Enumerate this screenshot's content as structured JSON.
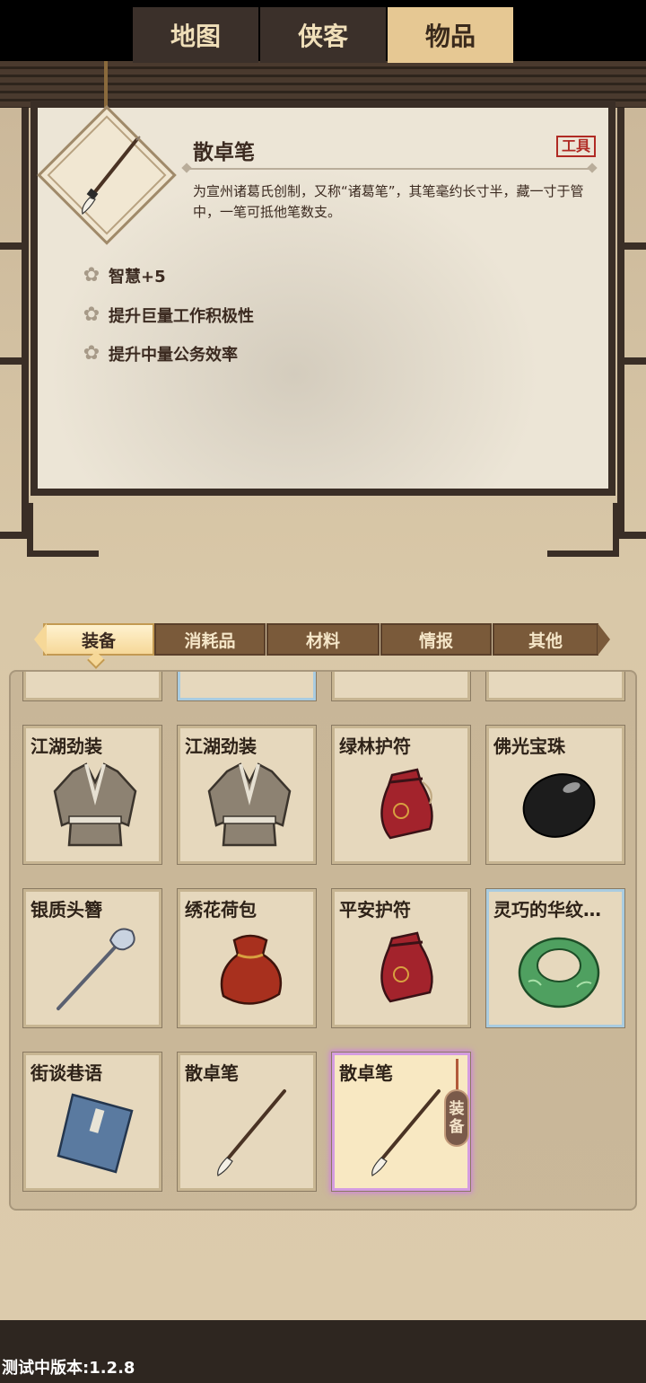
{
  "detail": {
    "name": "散卓笔",
    "type_tag": "工具",
    "description": "为宣州诸葛氏创制，又称“诸葛笔”，其笔毫约长寸半，藏一寸于管中，一笔可抵他笔数支。",
    "stats": [
      "智慧+5",
      "提升巨量工作积极性",
      "提升中量公务效率"
    ],
    "icon": "brush-icon"
  },
  "tabs": [
    {
      "label": "装备",
      "active": true
    },
    {
      "label": "消耗品",
      "active": false
    },
    {
      "label": "材料",
      "active": false
    },
    {
      "label": "情报",
      "active": false
    },
    {
      "label": "其他",
      "active": false
    }
  ],
  "items": [
    {
      "label": "江湖劲装",
      "icon": "robe-icon"
    },
    {
      "label": "江湖劲装",
      "icon": "robe-icon"
    },
    {
      "label": "绿林护符",
      "icon": "pouch-icon"
    },
    {
      "label": "佛光宝珠",
      "icon": "black-pearl-icon"
    },
    {
      "label": "银质头簪",
      "icon": "hairpin-icon"
    },
    {
      "label": "绣花荷包",
      "icon": "purse-icon"
    },
    {
      "label": "平安护符",
      "icon": "pouch-icon"
    },
    {
      "label": "灵巧的华纹…",
      "icon": "jade-ring-icon"
    },
    {
      "label": "街谈巷语",
      "icon": "book-icon"
    },
    {
      "label": "散卓笔",
      "icon": "brush-icon"
    },
    {
      "label": "散卓笔",
      "icon": "brush-icon",
      "equip_label": "装备"
    }
  ],
  "nav": {
    "map": "地图",
    "heroes": "侠客",
    "items": "物品"
  },
  "version": "测试中版本:1.2.8"
}
